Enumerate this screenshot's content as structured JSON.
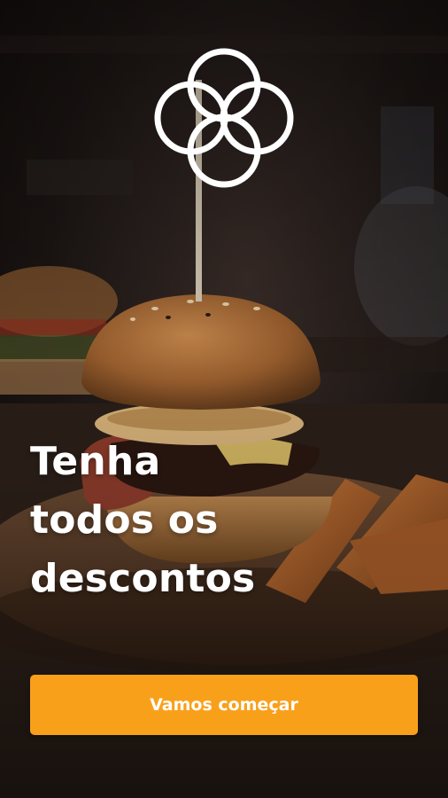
{
  "headline": {
    "line1": "Tenha",
    "line2": "todos os",
    "line3": "descontos"
  },
  "cta": {
    "label": "Vamos começar"
  },
  "colors": {
    "accent": "#f9a01b",
    "text": "#ffffff",
    "background": "#120d0b"
  },
  "icons": {
    "logo": "four-interlocking-circles-logo"
  }
}
